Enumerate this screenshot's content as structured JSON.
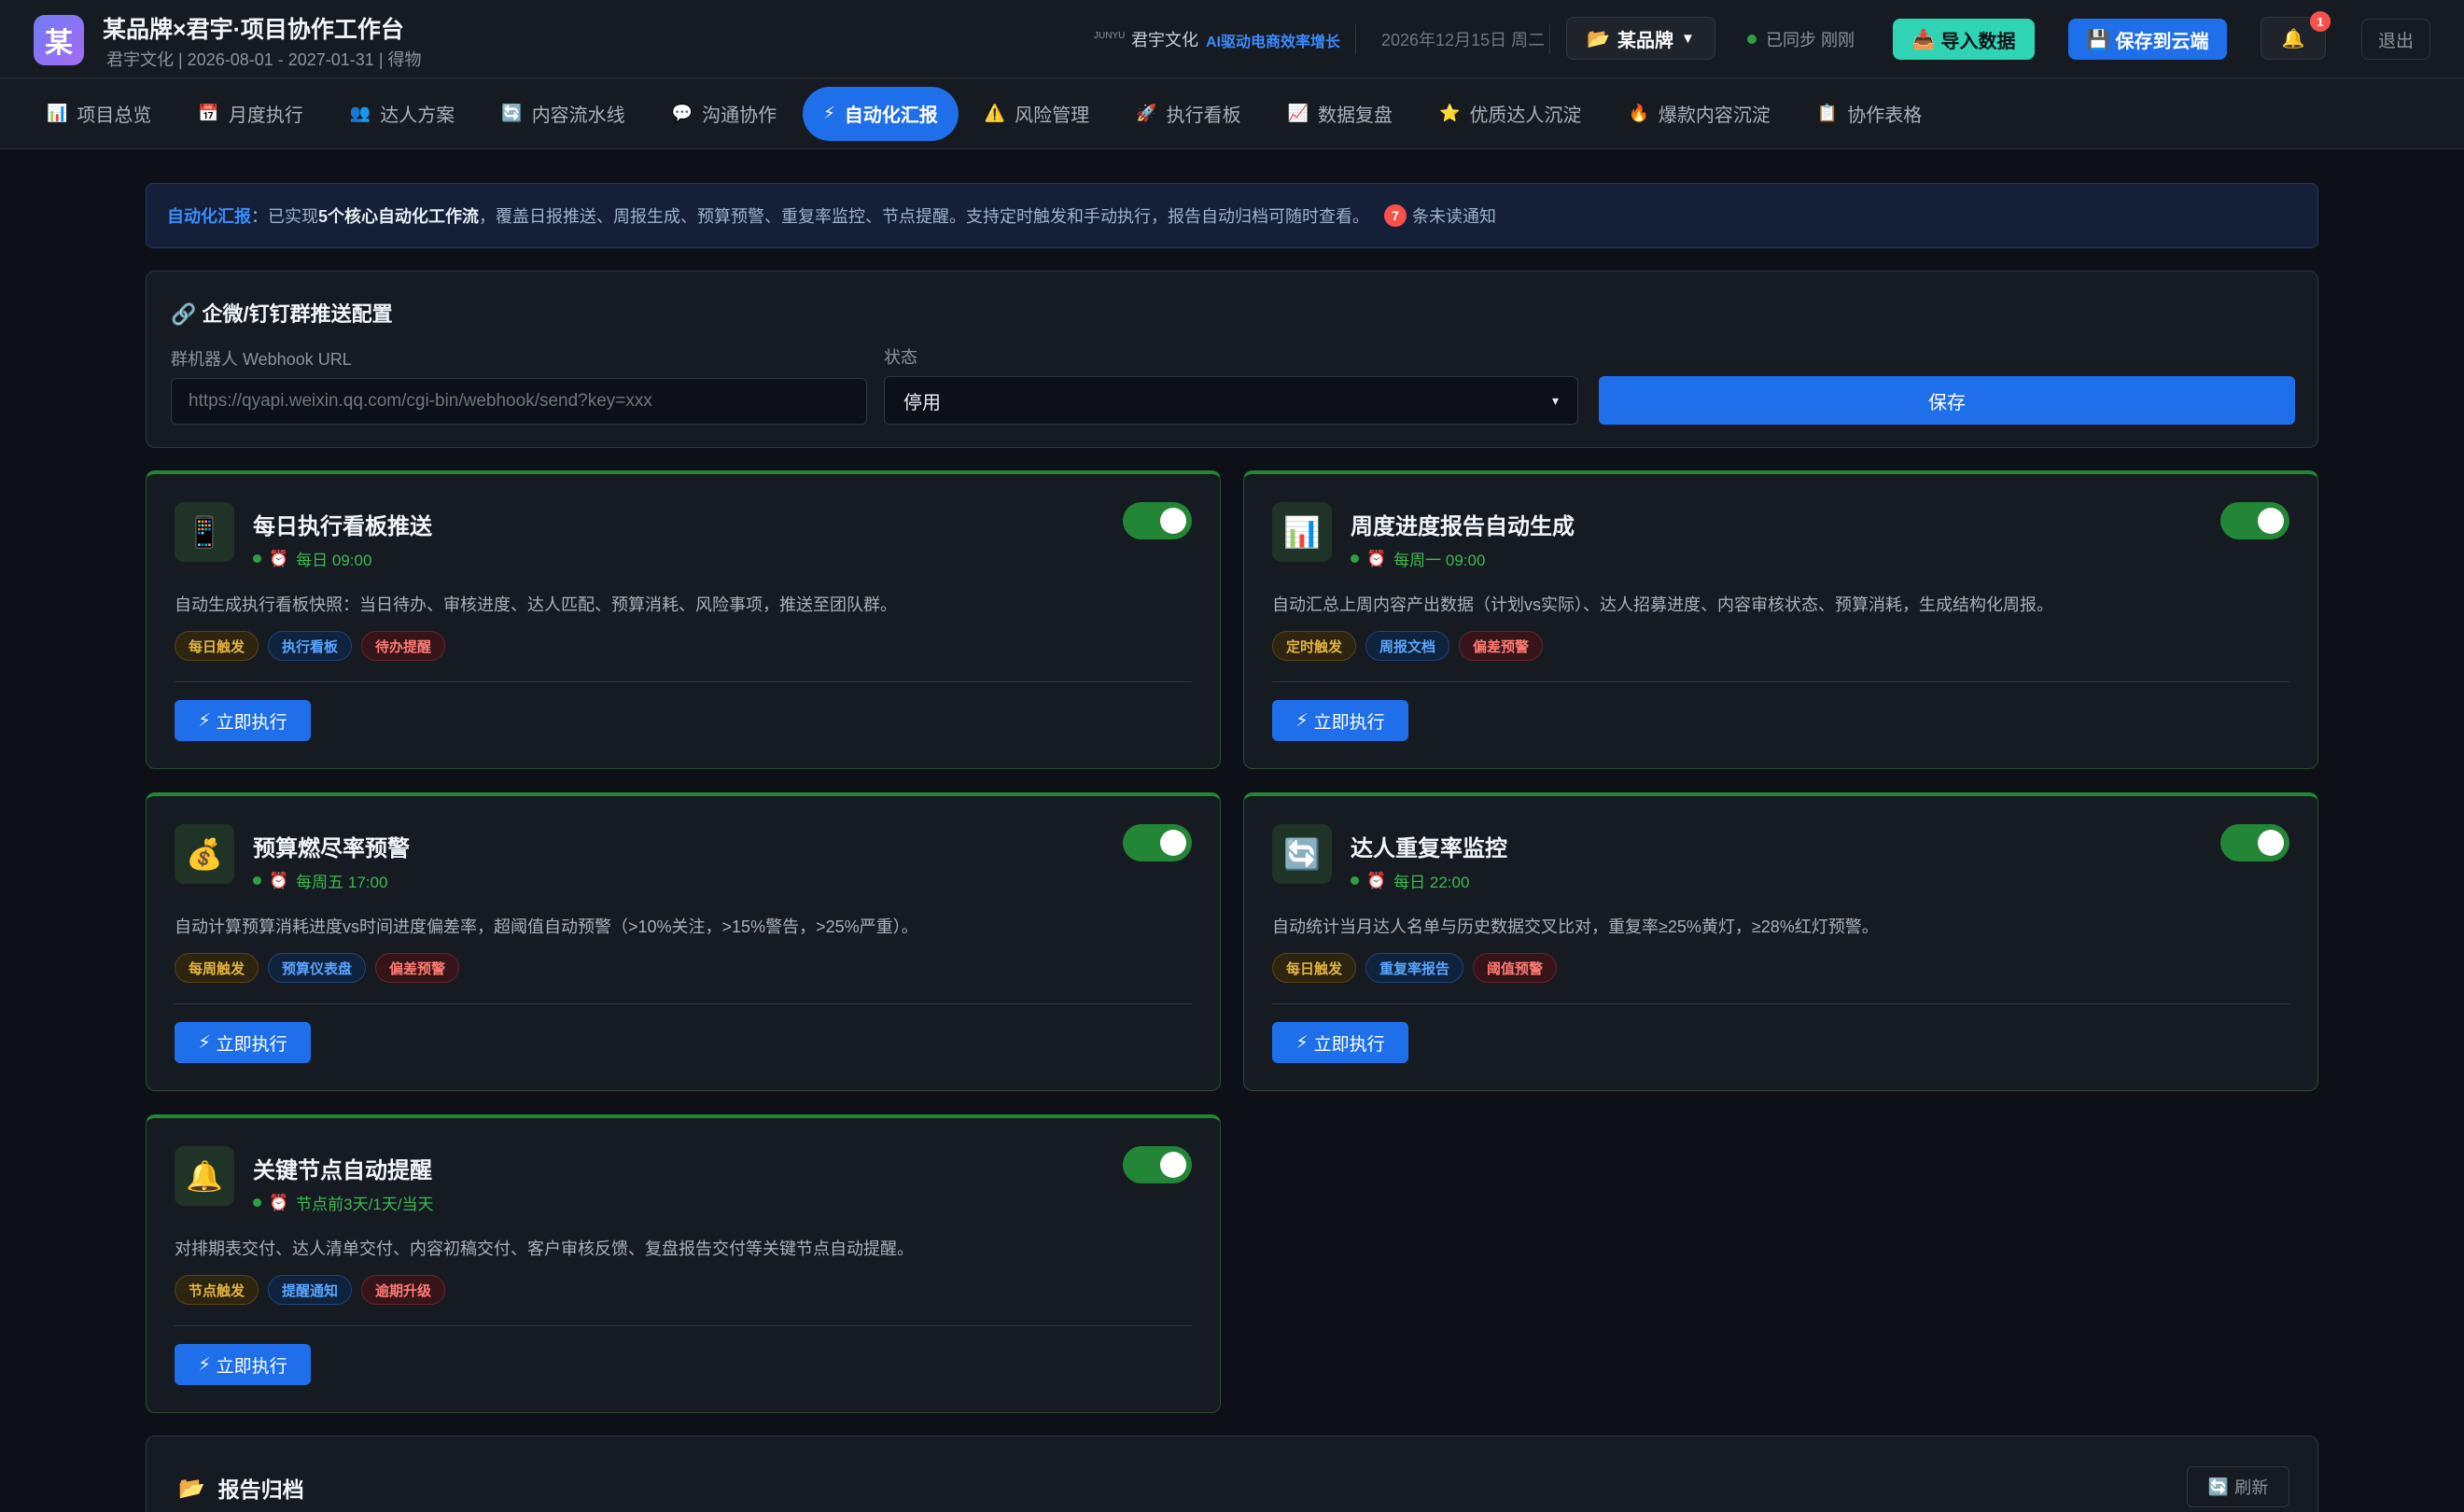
{
  "header": {
    "logo_char": "某",
    "title": "某品牌×君宇·项目协作工作台",
    "subtitle": "君宇文化 | 2026-08-01 - 2027-01-31 | 得物",
    "brand_mark": "JUNYU",
    "brand_name": "君宇文化",
    "brand_slogan": "AI驱动电商效率增长",
    "date": "2026年12月15日 周二",
    "brand_select": "某品牌",
    "sync_status": "已同步 刚刚",
    "import_label": "导入数据",
    "save_label": "保存到云端",
    "notification_count": "1",
    "logout_label": "退出"
  },
  "nav": {
    "tabs": [
      {
        "icon": "📊",
        "label": "项目总览"
      },
      {
        "icon": "📅",
        "label": "月度执行"
      },
      {
        "icon": "👥",
        "label": "达人方案"
      },
      {
        "icon": "🔄",
        "label": "内容流水线"
      },
      {
        "icon": "💬",
        "label": "沟通协作"
      },
      {
        "icon": "⚡",
        "label": "自动化汇报",
        "active": true
      },
      {
        "icon": "⚠️",
        "label": "风险管理"
      },
      {
        "icon": "🚀",
        "label": "执行看板"
      },
      {
        "icon": "📈",
        "label": "数据复盘"
      },
      {
        "icon": "⭐",
        "label": "优质达人沉淀"
      },
      {
        "icon": "🔥",
        "label": "爆款内容沉淀"
      },
      {
        "icon": "📋",
        "label": "协作表格"
      }
    ]
  },
  "notice": {
    "key": "自动化汇报",
    "text_1": "：已实现",
    "bold": "5个核心自动化工作流",
    "text_2": "，覆盖日报推送、周报生成、预算预警、重复率监控、节点提醒。支持定时触发和手动执行，报告自动归档可随时查看。",
    "unread_count": "7",
    "unread_label": "条未读通知"
  },
  "webhook": {
    "title": "🔗 企微/钉钉群推送配置",
    "url_label": "群机器人 Webhook URL",
    "url_placeholder": "https://qyapi.weixin.qq.com/cgi-bin/webhook/send?key=xxx",
    "status_label": "状态",
    "status_value": "停用",
    "save_label": "保存"
  },
  "run_label": "立即执行",
  "cards": [
    {
      "icon": "📱",
      "title": "每日执行看板推送",
      "schedule": "每日 09:00",
      "desc": "自动生成执行看板快照：当日待办、审核进度、达人匹配、预算消耗、风险事项，推送至团队群。",
      "tags": [
        "每日触发",
        "执行看板",
        "待办提醒"
      ],
      "enabled": true
    },
    {
      "icon": "📊",
      "title": "周度进度报告自动生成",
      "schedule": "每周一 09:00",
      "desc": "自动汇总上周内容产出数据（计划vs实际）、达人招募进度、内容审核状态、预算消耗，生成结构化周报。",
      "tags": [
        "定时触发",
        "周报文档",
        "偏差预警"
      ],
      "enabled": true
    },
    {
      "icon": "💰",
      "title": "预算燃尽率预警",
      "schedule": "每周五 17:00",
      "desc": "自动计算预算消耗进度vs时间进度偏差率，超阈值自动预警（>10%关注，>15%警告，>25%严重）。",
      "tags": [
        "每周触发",
        "预算仪表盘",
        "偏差预警"
      ],
      "enabled": true
    },
    {
      "icon": "🔄",
      "title": "达人重复率监控",
      "schedule": "每日 22:00",
      "desc": "自动统计当月达人名单与历史数据交叉比对，重复率≥25%黄灯，≥28%红灯预警。",
      "tags": [
        "每日触发",
        "重复率报告",
        "阈值预警"
      ],
      "enabled": true
    },
    {
      "icon": "🔔",
      "title": "关键节点自动提醒",
      "schedule": "节点前3天/1天/当天",
      "desc": "对排期表交付、达人清单交付、内容初稿交付、客户审核反馈、复盘报告交付等关键节点自动提醒。",
      "tags": [
        "节点触发",
        "提醒通知",
        "逾期升级"
      ],
      "enabled": true
    }
  ],
  "archive": {
    "icon": "📂",
    "title": "报告归档",
    "refresh_label": "刷新"
  }
}
